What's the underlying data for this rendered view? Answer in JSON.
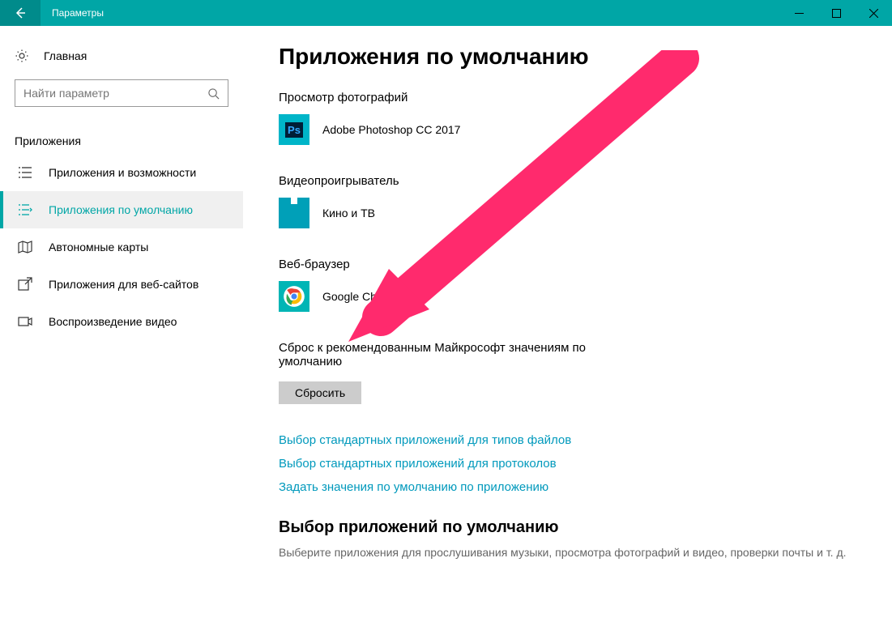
{
  "titlebar": {
    "app_title": "Параметры"
  },
  "sidebar": {
    "home_label": "Главная",
    "search_placeholder": "Найти параметр",
    "section_label": "Приложения",
    "items": [
      {
        "label": "Приложения и возможности"
      },
      {
        "label": "Приложения по умолчанию"
      },
      {
        "label": "Автономные карты"
      },
      {
        "label": "Приложения для веб-сайтов"
      },
      {
        "label": "Воспроизведение видео"
      }
    ]
  },
  "main": {
    "title": "Приложения по умолчанию",
    "sections": {
      "photos": {
        "heading": "Просмотр фотографий",
        "app": "Adobe Photoshop CC 2017"
      },
      "video": {
        "heading": "Видеопроигрыватель",
        "app": "Кино и ТВ"
      },
      "browser": {
        "heading": "Веб-браузер",
        "app": "Google Chrome"
      }
    },
    "reset": {
      "text": "Сброс к рекомендованным Майкрософт значениям по умолчанию",
      "button": "Сбросить"
    },
    "links": [
      "Выбор стандартных приложений для типов файлов",
      "Выбор стандартных приложений для протоколов",
      "Задать значения по умолчанию по приложению"
    ],
    "choose": {
      "heading": "Выбор приложений по умолчанию",
      "para": "Выберите приложения для прослушивания музыки, просмотра фотографий и видео, проверки почты и т. д."
    }
  },
  "annotation": {
    "color": "#ff2a6d"
  }
}
